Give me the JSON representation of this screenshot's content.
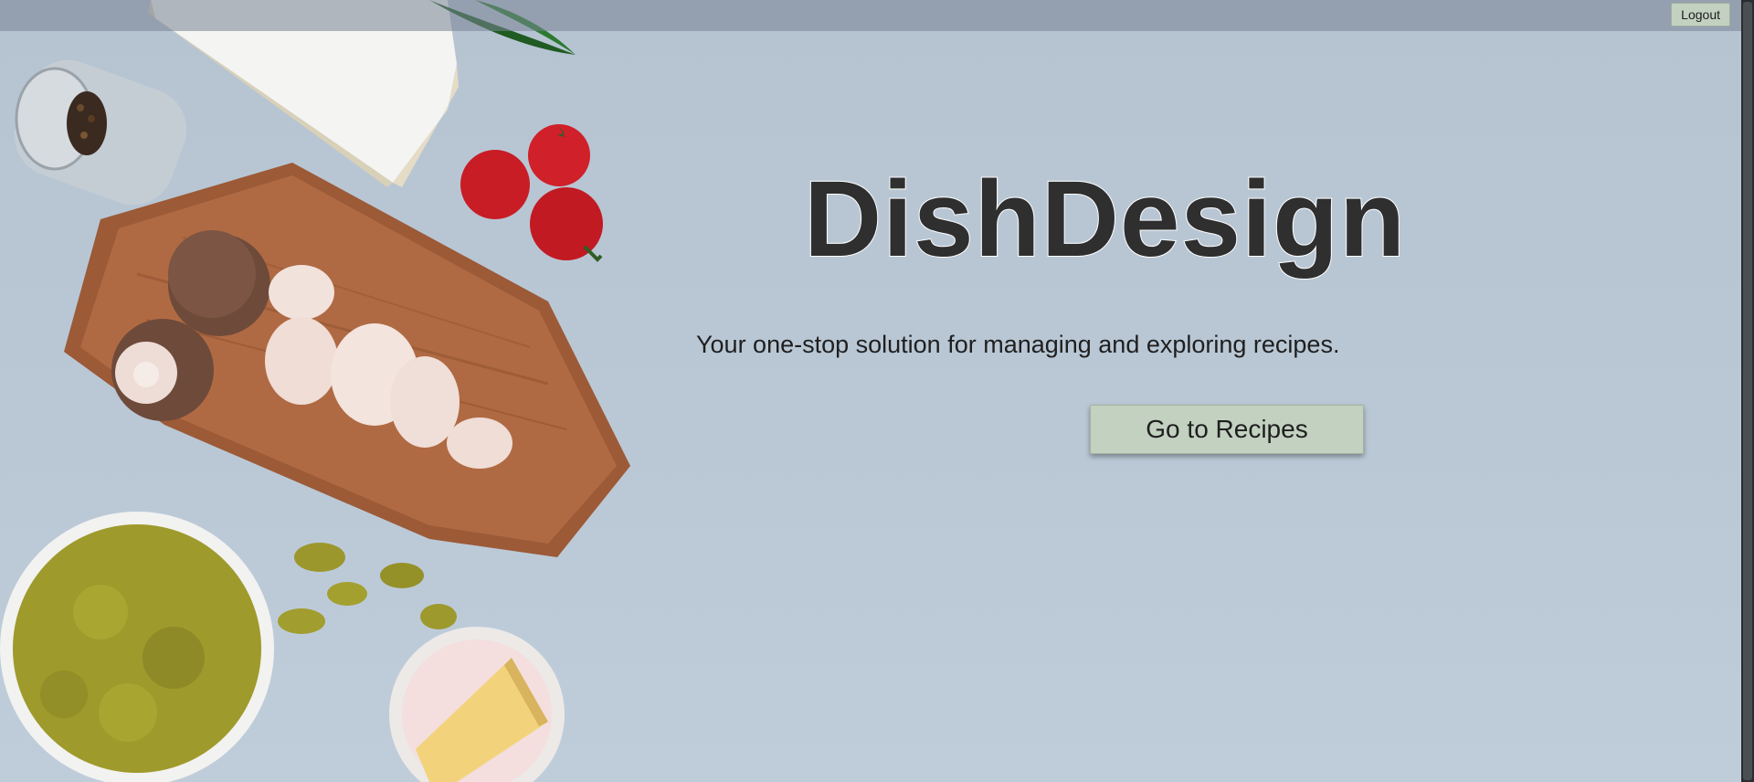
{
  "header": {
    "logout_label": "Logout"
  },
  "hero": {
    "title": "DishDesign",
    "subtitle": "Your one-stop solution for managing and exploring recipes.",
    "cta_label": "Go to Recipes"
  },
  "colors": {
    "background": "#b9c7d5",
    "button_bg": "#c3d1c1",
    "title_text": "#2f2f2f"
  },
  "decor_items": [
    "brie-cheese",
    "basil-leaf",
    "pepper-jar",
    "cutting-board",
    "mushrooms",
    "cherry-tomatoes",
    "pasta-bowl",
    "pasta-pieces",
    "parmesan-bowl"
  ]
}
